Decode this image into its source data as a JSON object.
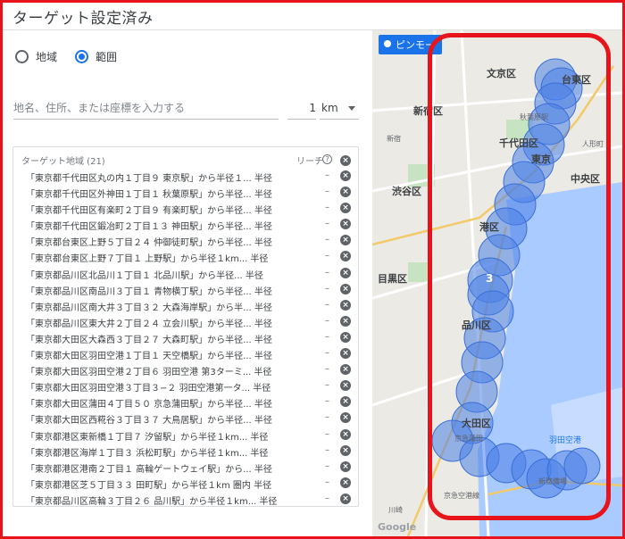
{
  "title": "ターゲット設定済み",
  "mode": {
    "options": [
      {
        "label": "地域",
        "selected": false
      },
      {
        "label": "範囲",
        "selected": true
      }
    ]
  },
  "search": {
    "placeholder": "地名、住所、または座標を入力する",
    "radius_value": "1",
    "radius_unit": "km"
  },
  "target_list": {
    "header": "ターゲット地域 (21)",
    "reach_header": "リーチ",
    "help_glyph": "?",
    "remove_glyph": "×",
    "items": [
      {
        "location": "「東京都千代田区丸の内１丁目９ 東京駅」から半径１... 半径",
        "reach": "–"
      },
      {
        "location": "「東京都千代田区外神田１丁目１ 秋葉原駅」から半径... 半径",
        "reach": "–"
      },
      {
        "location": "「東京都千代田区有楽町２丁目９ 有楽町駅」から半径... 半径",
        "reach": "–"
      },
      {
        "location": "「東京都千代田区鍛冶町２丁目１３ 神田駅」から半径... 半径",
        "reach": "–"
      },
      {
        "location": "「東京都台東区上野５丁目２４ 仲御徒町駅」から半径... 半径",
        "reach": "–"
      },
      {
        "location": "「東京都台東区上野７丁目１ 上野駅」から半径１km... 半径",
        "reach": "–"
      },
      {
        "location": "「東京都品川区北品川１丁目１ 北品川駅」から半径... 半径",
        "reach": "–"
      },
      {
        "location": "「東京都品川区南品川３丁目１ 青物横丁駅」から半径... 半径",
        "reach": "–"
      },
      {
        "location": "「東京都品川区南大井３丁目３２ 大森海岸駅」から半... 半径",
        "reach": "–"
      },
      {
        "location": "「東京都品川区東大井２丁目２４ 立会川駅」から半径... 半径",
        "reach": "–"
      },
      {
        "location": "「東京都大田区大森西３丁目２７ 大森町駅」から半径... 半径",
        "reach": "–"
      },
      {
        "location": "「東京都大田区羽田空港１丁目１ 天空橋駅」から半径... 半径",
        "reach": "–"
      },
      {
        "location": "「東京都大田区羽田空港２丁目６ 羽田空港 第3ターミ... 半径",
        "reach": "–"
      },
      {
        "location": "「東京都大田区羽田空港３丁目３−２ 羽田空港第一タ... 半径",
        "reach": "–"
      },
      {
        "location": "「東京都大田区蒲田４丁目５０ 京急蒲田駅」から半径... 半径",
        "reach": "–"
      },
      {
        "location": "「東京都大田区西糀谷３丁目３７ 大鳥居駅」から半径... 半径",
        "reach": "–"
      },
      {
        "location": "「東京都港区東新橋１丁目７ 汐留駅」から半径１km... 半径",
        "reach": "–"
      },
      {
        "location": "「東京都港区海岸１丁目３ 浜松町駅」から半径１km... 半径",
        "reach": "–"
      },
      {
        "location": "「東京都港区港南２丁目１ 高輪ゲートウェイ駅」から... 半径",
        "reach": "–"
      },
      {
        "location": "「東京都港区芝５丁目３３ 田町駅」から半径１km 圏内 半径",
        "reach": "–"
      },
      {
        "location": "「東京都品川区高輪３丁目２６ 品川駅」から半径１km... 半径",
        "reach": "–"
      }
    ]
  },
  "map": {
    "pin_button": "ピンモー",
    "cluster_count": "3",
    "labels": [
      {
        "text": "文京区",
        "cls": ""
      },
      {
        "text": "台東区",
        "cls": ""
      },
      {
        "text": "新宿区",
        "cls": ""
      },
      {
        "text": "千代田区",
        "cls": ""
      },
      {
        "text": "東京",
        "cls": ""
      },
      {
        "text": "中央区",
        "cls": ""
      },
      {
        "text": "渋谷区",
        "cls": ""
      },
      {
        "text": "港区",
        "cls": ""
      },
      {
        "text": "目黒区",
        "cls": ""
      },
      {
        "text": "品川区",
        "cls": ""
      },
      {
        "text": "大田区",
        "cls": ""
      },
      {
        "text": "羽田空港",
        "cls": "airport"
      },
      {
        "text": "秋葉原駅",
        "cls": "small"
      },
      {
        "text": "新宿",
        "cls": "small"
      },
      {
        "text": "人形町",
        "cls": "small"
      },
      {
        "text": "京急蒲田",
        "cls": "small"
      },
      {
        "text": "川崎",
        "cls": "small"
      },
      {
        "text": "新整備場",
        "cls": "small"
      },
      {
        "text": "京急空港線",
        "cls": "small"
      }
    ],
    "attribution": "Google",
    "colors": {
      "circle_fill": "#4a7fe6",
      "land": "#eceae4",
      "water": "#aacbff",
      "highlight": "#e8141b"
    }
  }
}
